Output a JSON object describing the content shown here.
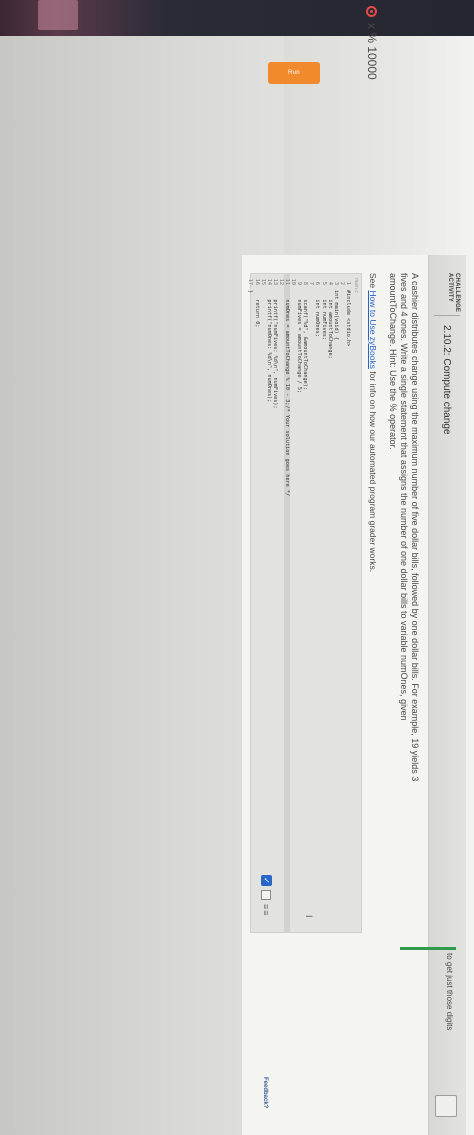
{
  "formula": {
    "text": "x % 10000"
  },
  "activity": {
    "label_line1": "CHALLENGE",
    "label_line2": "ACTIVITY",
    "title": "2.10.2: Compute change"
  },
  "instructions": {
    "line1": "A cashier distributes change using the maximum number of five dollar bills, followed by one dollar bills. For example, 19 yields 3",
    "line2": "fives and 4 ones. Write a single statement that assigns the number of one dollar bills to variable numOnes, given",
    "line3": "amountToChange. Hint: Use the % operator."
  },
  "see_link": {
    "prefix": "See ",
    "link_text": "How to Use zyBooks",
    "suffix": " for info on how our automated program grader works."
  },
  "editor": {
    "header": "main.c",
    "lines": [
      {
        "n": "1",
        "code": "#include <stdio.h>"
      },
      {
        "n": "2",
        "code": ""
      },
      {
        "n": "3",
        "code": "int main(void) {"
      },
      {
        "n": "4",
        "code": "   int amountToChange;"
      },
      {
        "n": "5",
        "code": "   int numFives;"
      },
      {
        "n": "6",
        "code": "   int numOnes;"
      },
      {
        "n": "7",
        "code": ""
      },
      {
        "n": "8",
        "code": "   scanf(\"%d\", &amountToChange);"
      },
      {
        "n": "9",
        "code": "   numFives = amountToChange / 5;"
      },
      {
        "n": "10",
        "code": ""
      },
      {
        "n": "11",
        "code": "   numOnes = amountToChange % 10 - 3;/* Your solution goes here */"
      },
      {
        "n": "12",
        "code": ""
      },
      {
        "n": "13",
        "code": "   printf(\"numFives: %d\\n\", numFives);"
      },
      {
        "n": "14",
        "code": "   printf(\"numOnes: %d\\n\", numOnes);"
      },
      {
        "n": "15",
        "code": ""
      },
      {
        "n": "16",
        "code": "   return 0;"
      },
      {
        "n": "17",
        "code": "}"
      }
    ],
    "cursor": "I"
  },
  "run_button": {
    "label": "Run"
  },
  "hint_text": "to get just those digits",
  "feedback": "Feedback?",
  "tools": {
    "check": "✓",
    "bars": "≡≡"
  }
}
